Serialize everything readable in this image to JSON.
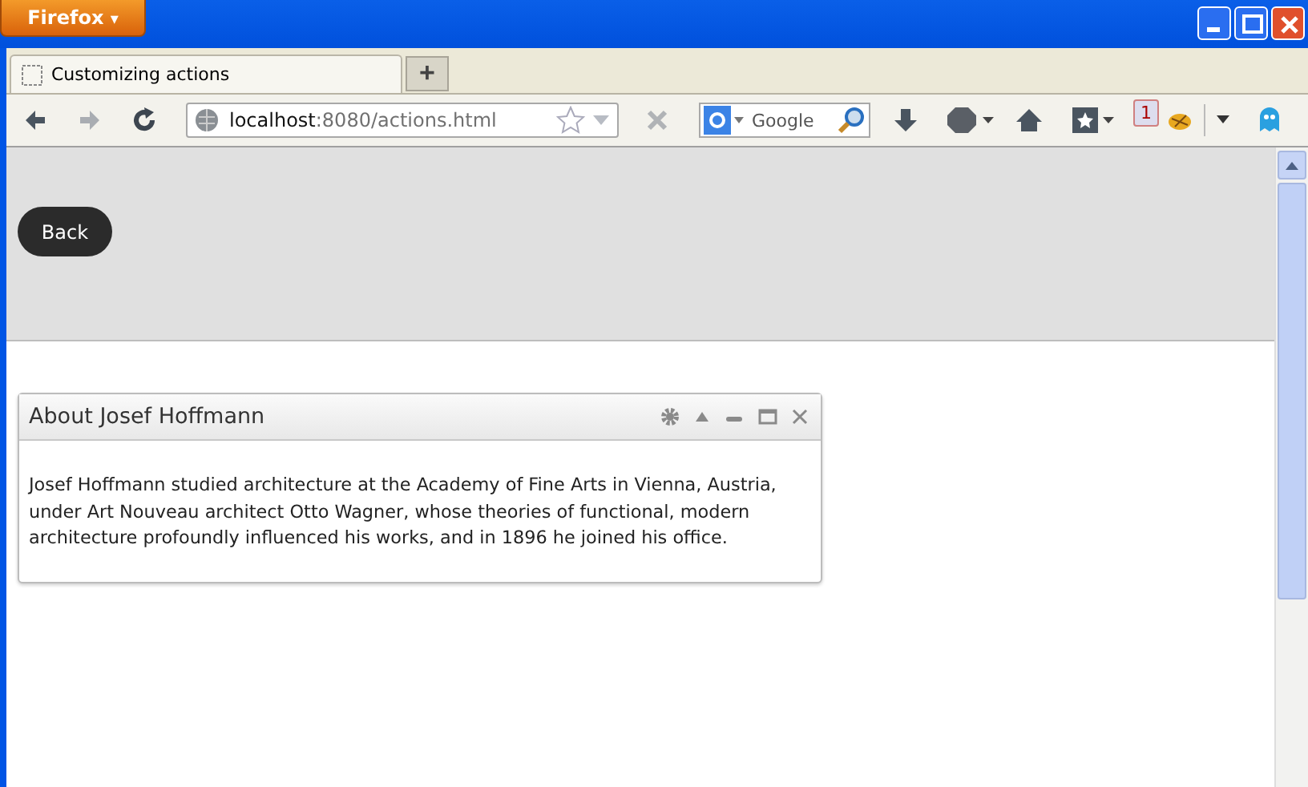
{
  "app_button": {
    "label": "Firefox",
    "caret": "▾"
  },
  "tabs": [
    {
      "label": "Customizing actions",
      "selected": true
    }
  ],
  "new_tab": "+",
  "address": {
    "host": "localhost",
    "path": ":8080/actions.html"
  },
  "search": {
    "placeholder": "Google"
  },
  "notification_badge": "1",
  "page": {
    "back_button": "Back",
    "portlet": {
      "title": "About Josef Hoffmann",
      "body": "Josef Hoffmann studied architecture at the Academy of Fine Arts in Vienna, Austria, under Art Nouveau architect Otto Wagner, whose theories of functional, modern architecture profoundly influenced his works, and in 1896 he joined his office."
    }
  }
}
